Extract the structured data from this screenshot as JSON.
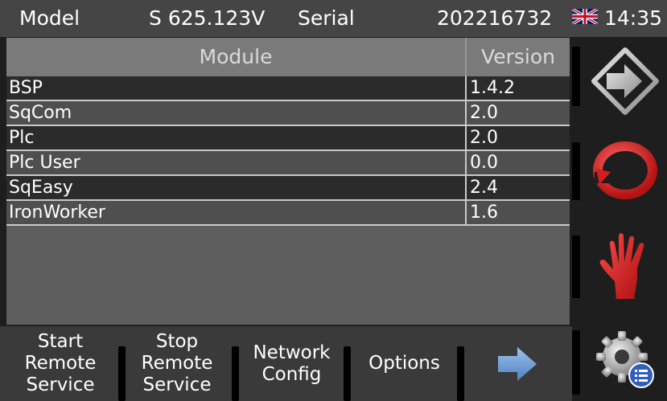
{
  "header": {
    "model_label": "Model",
    "model_value": "S 625.123V",
    "serial_label": "Serial",
    "serial_value": "202216732",
    "flag_icon": "uk-flag-icon",
    "time": "14:35"
  },
  "table": {
    "columns": [
      "Module",
      "Version"
    ],
    "rows": [
      {
        "module": "BSP",
        "version": "1.4.2"
      },
      {
        "module": "SqCom",
        "version": "2.0"
      },
      {
        "module": "Plc",
        "version": "2.0"
      },
      {
        "module": "Plc User",
        "version": "0.0"
      },
      {
        "module": "SqEasy",
        "version": "2.4"
      },
      {
        "module": "IronWorker",
        "version": "1.6"
      }
    ]
  },
  "bottom_bar": {
    "start_remote": [
      "Start",
      "Remote",
      "Service"
    ],
    "stop_remote": [
      "Stop",
      "Remote",
      "Service"
    ],
    "network_config": [
      "Network",
      "Config"
    ],
    "options": "Options",
    "next_icon": "arrow-right-icon"
  },
  "side_bar": {
    "icons": [
      "exit-arrow-icon",
      "cycle-icon",
      "stop-hand-icon",
      "settings-gear-icon"
    ]
  },
  "colors": {
    "header_bg": "#454545",
    "table_header_bg": "#7a7a7a",
    "row_dark": "#2b2b2b",
    "row_light": "#4f4f4f",
    "accent_red": "#d21e1e",
    "arrow_blue": "#6f9ed6"
  }
}
